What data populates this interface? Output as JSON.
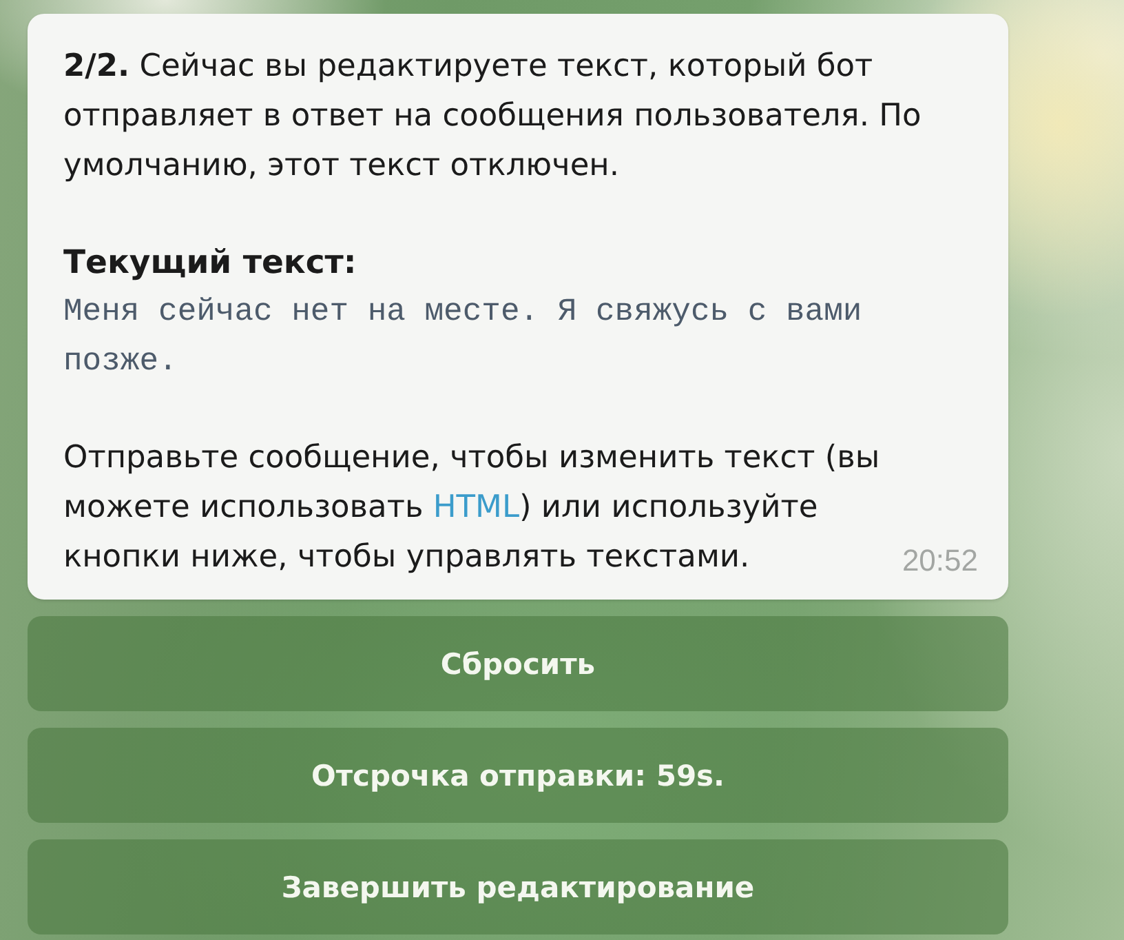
{
  "message": {
    "intro": "**2/2.** Сейчас вы редактируете текст, который бот отправляет в ответ на сообщения пользователя. По умолчанию, этот текст отключен.",
    "current_label": "Текущий текст:",
    "current_text": "Меня сейчас нет на месте. Я свяжусь с вами позже.",
    "instruction": {
      "before": "Отправьте сообщение, чтобы изменить текст (вы можете использовать ",
      "link": "HTML",
      "after": ") или используйте кнопки ниже, чтобы управлять текстами."
    },
    "time": "20:52"
  },
  "buttons": [
    {
      "label": "Сбросить"
    },
    {
      "label": "Отсрочка отправки: 59s."
    },
    {
      "label": "Завершить редактирование"
    }
  ]
}
